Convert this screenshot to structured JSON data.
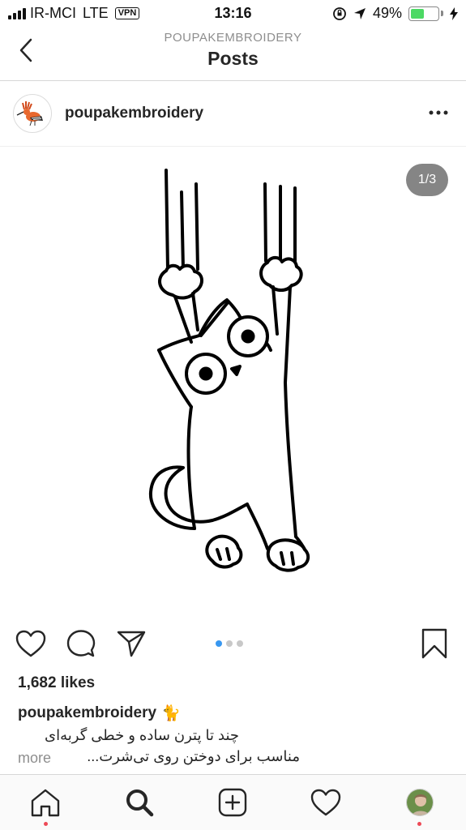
{
  "status_bar": {
    "carrier": "IR-MCI",
    "network": "LTE",
    "vpn": "VPN",
    "time": "13:16",
    "battery": "49%",
    "battery_level": 0.49,
    "battery_color": "#4cd964"
  },
  "header": {
    "username": "POUPAKEMBROIDERY",
    "title": "Posts"
  },
  "post": {
    "username": "poupakembroidery",
    "image_counter": "1/3",
    "carousel": {
      "total": 3,
      "active_index": 0
    },
    "likes": "1,682 likes",
    "caption_username": "poupakembroidery",
    "caption_emoji": "🐈",
    "caption_line1": "چند تا پترن ساده و خطی گربه‌ای",
    "caption_line2": "مناسب برای دوختن روی تی‌شرت... ",
    "more": "more"
  },
  "icons": {
    "back": "chevron-left-icon",
    "more": "more-horizontal-icon",
    "like": "heart-icon",
    "comment": "comment-icon",
    "share": "send-icon",
    "save": "bookmark-icon",
    "home": "home-icon",
    "search": "search-icon",
    "add": "add-post-icon",
    "activity": "heart-icon",
    "profile": "profile-avatar"
  },
  "colors": {
    "accent": "#3897f0",
    "notification": "#ed4956",
    "muted": "#8e8e8e"
  }
}
